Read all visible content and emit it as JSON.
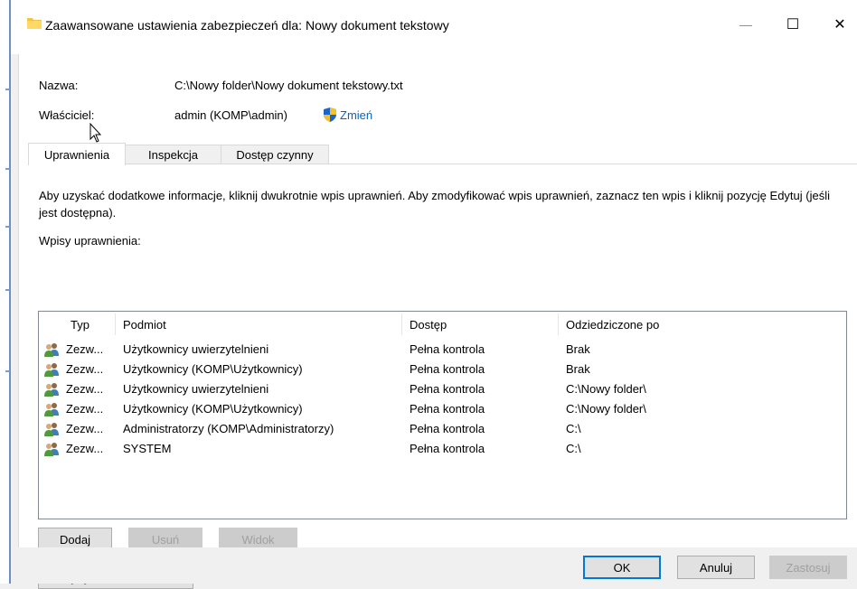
{
  "window": {
    "title": "Zaawansowane ustawienia zabezpieczeń dla: Nowy dokument tekstowy",
    "minimize_glyph": "—",
    "maximize_glyph": "☐",
    "close_glyph": "✕"
  },
  "info": {
    "name_label": "Nazwa:",
    "name_value": "C:\\Nowy folder\\Nowy dokument tekstowy.txt",
    "owner_label": "Właściciel:",
    "owner_value": "admin (KOMP\\admin)",
    "change_link": "Zmień"
  },
  "tabs": [
    "Uprawnienia",
    "Inspekcja",
    "Dostęp czynny"
  ],
  "description": "Aby uzyskać dodatkowe informacje, kliknij dwukrotnie wpis uprawnień. Aby zmodyfikować wpis uprawnień, zaznacz ten wpis i kliknij pozycję Edytuj (jeśli jest dostępna).",
  "entries_label": "Wpisy uprawnienia:",
  "table": {
    "columns": [
      "Typ",
      "Podmiot",
      "Dostęp",
      "Odziedziczone po"
    ],
    "rows": [
      [
        "Zezw...",
        "Użytkownicy uwierzytelnieni",
        "Pełna kontrola",
        "Brak"
      ],
      [
        "Zezw...",
        "Użytkownicy (KOMP\\Użytkownicy)",
        "Pełna kontrola",
        "Brak"
      ],
      [
        "Zezw...",
        "Użytkownicy uwierzytelnieni",
        "Pełna kontrola",
        "C:\\Nowy folder\\"
      ],
      [
        "Zezw...",
        "Użytkownicy (KOMP\\Użytkownicy)",
        "Pełna kontrola",
        "C:\\Nowy folder\\"
      ],
      [
        "Zezw...",
        "Administratorzy (KOMP\\Administratorzy)",
        "Pełna kontrola",
        "C:\\"
      ],
      [
        "Zezw...",
        "SYSTEM",
        "Pełna kontrola",
        "C:\\"
      ]
    ]
  },
  "buttons": {
    "add": "Dodaj",
    "remove": "Usuń",
    "view": "Widok",
    "disable_inheritance": "Wyłącz dziedziczenie",
    "ok": "OK",
    "cancel": "Anuluj",
    "apply": "Zastosuj"
  },
  "icons": {
    "title": "folder-icon",
    "change": "uac-shield-icon",
    "row": "users-icon",
    "pointer": "mouse-cursor-icon"
  },
  "colors": {
    "link": "#0066cc",
    "selection_border": "#0078d7",
    "folder": "#f5c342"
  }
}
